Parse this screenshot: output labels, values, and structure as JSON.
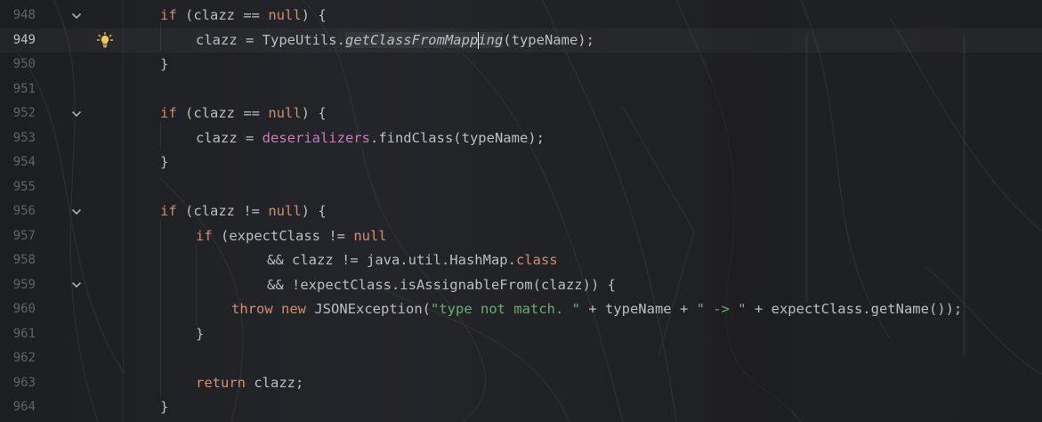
{
  "editor": {
    "lines": [
      {
        "num": "948",
        "fold": true,
        "bulb": false,
        "current": false,
        "indent": 180,
        "tokens": [
          [
            "kw",
            "if"
          ],
          [
            "p",
            " (clazz == "
          ],
          [
            "kw",
            "null"
          ],
          [
            "p",
            ") {"
          ]
        ]
      },
      {
        "num": "949",
        "fold": false,
        "bulb": true,
        "current": true,
        "indent": 220,
        "tokens": [
          [
            "p",
            "clazz = TypeUtils."
          ],
          [
            "ital",
            "getClassFromMapp"
          ],
          [
            "caret",
            ""
          ],
          [
            "ital",
            "ing"
          ],
          [
            "p",
            "(typeName);"
          ]
        ]
      },
      {
        "num": "950",
        "fold": false,
        "bulb": false,
        "current": false,
        "indent": 180,
        "tokens": [
          [
            "p",
            "}"
          ]
        ]
      },
      {
        "num": "951",
        "fold": false,
        "bulb": false,
        "current": false,
        "indent": 180,
        "tokens": []
      },
      {
        "num": "952",
        "fold": true,
        "bulb": false,
        "current": false,
        "indent": 180,
        "tokens": [
          [
            "kw",
            "if"
          ],
          [
            "p",
            " (clazz == "
          ],
          [
            "kw",
            "null"
          ],
          [
            "p",
            ") {"
          ]
        ]
      },
      {
        "num": "953",
        "fold": false,
        "bulb": false,
        "current": false,
        "indent": 220,
        "tokens": [
          [
            "p",
            "clazz = "
          ],
          [
            "fld",
            "deserializers"
          ],
          [
            "p",
            ".findClass(typeName);"
          ]
        ]
      },
      {
        "num": "954",
        "fold": false,
        "bulb": false,
        "current": false,
        "indent": 180,
        "tokens": [
          [
            "p",
            "}"
          ]
        ]
      },
      {
        "num": "955",
        "fold": false,
        "bulb": false,
        "current": false,
        "indent": 180,
        "tokens": []
      },
      {
        "num": "956",
        "fold": true,
        "bulb": false,
        "current": false,
        "indent": 180,
        "tokens": [
          [
            "kw",
            "if"
          ],
          [
            "p",
            " (clazz != "
          ],
          [
            "kw",
            "null"
          ],
          [
            "p",
            ") {"
          ]
        ]
      },
      {
        "num": "957",
        "fold": false,
        "bulb": false,
        "current": false,
        "indent": 220,
        "tokens": [
          [
            "kw",
            "if"
          ],
          [
            "p",
            " (expectClass != "
          ],
          [
            "kw",
            "null"
          ]
        ]
      },
      {
        "num": "958",
        "fold": false,
        "bulb": false,
        "current": false,
        "indent": 300,
        "tokens": [
          [
            "p",
            "&& clazz != java.util.HashMap."
          ],
          [
            "kw",
            "class"
          ]
        ]
      },
      {
        "num": "959",
        "fold": true,
        "bulb": false,
        "current": false,
        "indent": 300,
        "tokens": [
          [
            "p",
            "&& !expectClass.isAssignableFrom(clazz)) {"
          ]
        ]
      },
      {
        "num": "960",
        "fold": false,
        "bulb": false,
        "current": false,
        "indent": 260,
        "tokens": [
          [
            "kw",
            "throw"
          ],
          [
            "p",
            " "
          ],
          [
            "kw",
            "new"
          ],
          [
            "p",
            " JSONException("
          ],
          [
            "str",
            "\"type not match. \""
          ],
          [
            "p",
            " + typeName + "
          ],
          [
            "str",
            "\" -> \""
          ],
          [
            "p",
            " + expectClass.getName());"
          ]
        ]
      },
      {
        "num": "961",
        "fold": false,
        "bulb": false,
        "current": false,
        "indent": 220,
        "tokens": [
          [
            "p",
            "}"
          ]
        ]
      },
      {
        "num": "962",
        "fold": false,
        "bulb": false,
        "current": false,
        "indent": 220,
        "tokens": []
      },
      {
        "num": "963",
        "fold": false,
        "bulb": false,
        "current": false,
        "indent": 220,
        "tokens": [
          [
            "kw",
            "return"
          ],
          [
            "p",
            " clazz;"
          ]
        ]
      },
      {
        "num": "964",
        "fold": false,
        "bulb": false,
        "current": false,
        "indent": 180,
        "tokens": [
          [
            "p",
            "}"
          ]
        ]
      }
    ]
  },
  "colors": {
    "keyword": "#cf8e6d",
    "field": "#c77dbb",
    "string": "#6aab73",
    "text": "#bcbec4",
    "line_number": "#5f6369",
    "bulb": "#f2c94c"
  },
  "icons": {
    "fold": "chevron-down-icon",
    "intention": "lightbulb-icon"
  }
}
